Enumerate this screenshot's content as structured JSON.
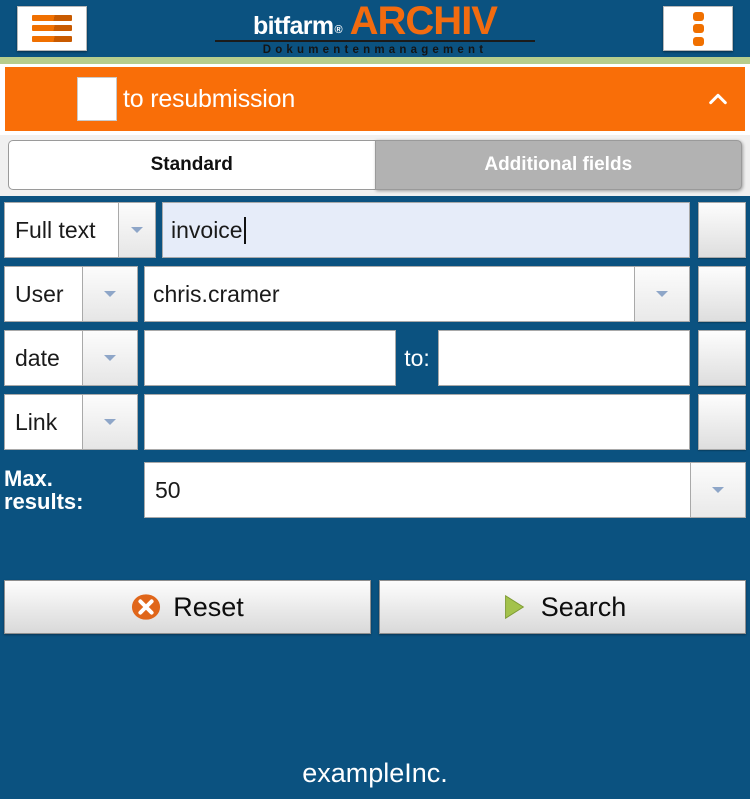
{
  "header": {
    "menu_icon": "hamburger-icon",
    "overflow_icon": "kebab-menu-icon",
    "logo_brand": "bitfarm",
    "logo_registered": "®",
    "logo_product": "ARCHIV",
    "logo_subtitle": "Dokumentenmanagement"
  },
  "resubmission": {
    "label": "to resubmission",
    "checked": false,
    "collapse_icon": "chevron-up-icon"
  },
  "tabs": [
    {
      "label": "Standard",
      "active": true
    },
    {
      "label": "Additional fields",
      "active": false
    }
  ],
  "form": {
    "rows": [
      {
        "label": "Full text",
        "value": "invoice",
        "placeholder": "",
        "focused": true
      },
      {
        "label": "User",
        "value": "chris.cramer",
        "placeholder": "",
        "focused": false
      },
      {
        "label": "date",
        "value": "",
        "to_label": "to:",
        "value_to": "",
        "focused": false
      },
      {
        "label": "Link",
        "value": "",
        "placeholder": "",
        "focused": false
      }
    ],
    "max_results": {
      "label_line1": "Max.",
      "label_line2": "results:",
      "value": "50"
    }
  },
  "actions": {
    "reset": {
      "label": "Reset",
      "icon": "reset-circle-x-icon"
    },
    "search": {
      "label": "Search",
      "icon": "play-triangle-icon"
    }
  },
  "footer": {
    "company": "exampleInc."
  },
  "colors": {
    "background_blue": "#0b5280",
    "accent_orange": "#f96e08",
    "logo_orange": "#f26b0f",
    "green_strip": "#b6cd8d",
    "tab_inactive_gray": "#b2b2b2",
    "focused_input": "#e6ecf9",
    "reset_icon_orange": "#e0661a",
    "search_icon_green": "#a3c24b"
  }
}
